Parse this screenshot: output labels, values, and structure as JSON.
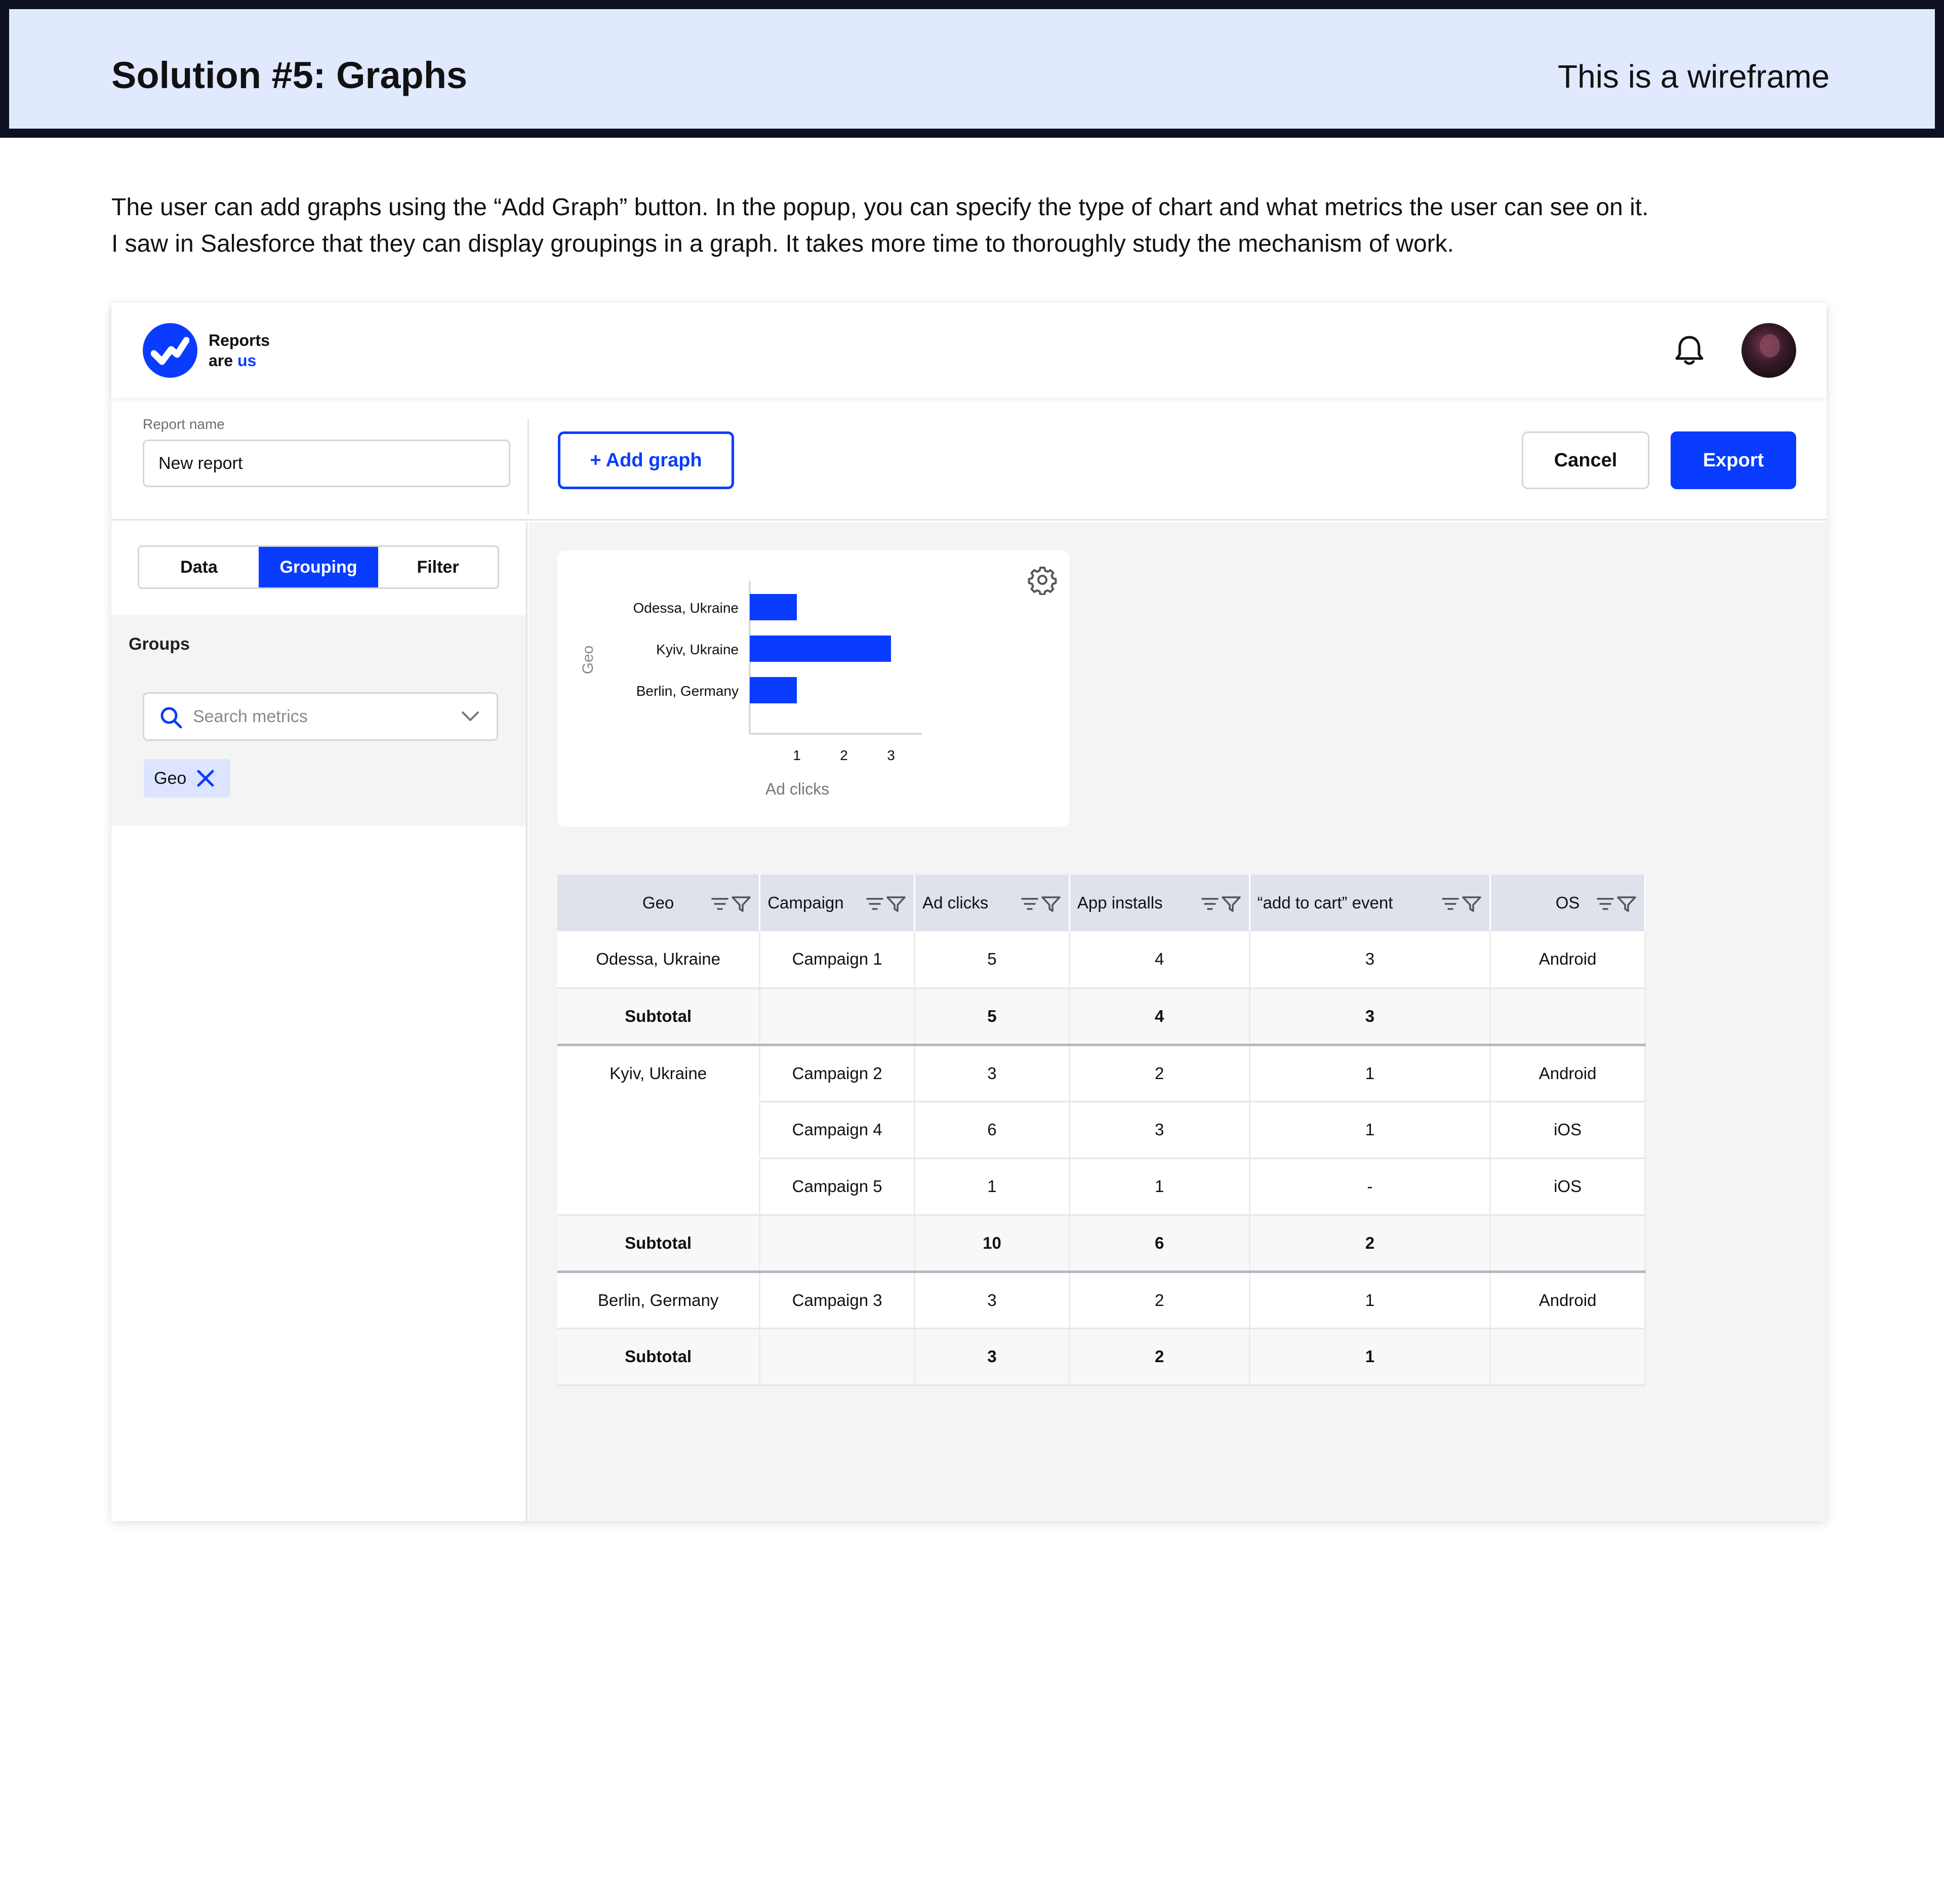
{
  "banner": {
    "title": "Solution #5: Graphs",
    "note": "This is a wireframe"
  },
  "description": {
    "line1": "The user can add graphs using the “Add Graph” button. In the popup, you can specify the type of chart and what metrics the user can see on it.",
    "line2": "I saw in Salesforce that they can display groupings in a graph. It takes more time to thoroughly study the mechanism of work."
  },
  "app": {
    "logo_line1": "Reports",
    "logo_line2_a": "are ",
    "logo_line2_b": "us",
    "icons": {
      "notification": "bell-icon",
      "user": "avatar"
    },
    "report_name_label": "Report name",
    "report_name_value": "New report",
    "add_graph_label": "+ Add graph",
    "cancel_label": "Cancel",
    "export_label": "Export",
    "tabs": [
      {
        "label": "Data",
        "active": false
      },
      {
        "label": "Grouping",
        "active": true
      },
      {
        "label": "Filter",
        "active": false
      }
    ],
    "groups_title": "Groups",
    "search_placeholder": "Search metrics",
    "chip_label": "Geo",
    "accent_color": "#0a3cff"
  },
  "chart_data": {
    "type": "bar",
    "orientation": "horizontal",
    "categories": [
      "Odessa, Ukraine",
      "Kyiv, Ukraine",
      "Berlin, Germany"
    ],
    "values": [
      1,
      3,
      1
    ],
    "xlabel": "Ad clicks",
    "ylabel": "Geo",
    "xticks": [
      1,
      2,
      3
    ],
    "xlim": [
      0,
      3.6
    ],
    "grid": false,
    "color": "#0a3cff"
  },
  "table": {
    "columns": [
      "Geo",
      "Campaign",
      "Ad clicks",
      "App installs",
      "“add to cart” event",
      "OS"
    ],
    "rows": [
      {
        "cells": [
          "Odessa, Ukraine",
          "Campaign 1",
          "5",
          "4",
          "3",
          "Android"
        ],
        "kind": "data"
      },
      {
        "cells": [
          "Subtotal",
          "",
          "5",
          "4",
          "3",
          ""
        ],
        "kind": "sub"
      },
      {
        "cells": [
          "Kyiv, Ukraine",
          "Campaign 2",
          "3",
          "2",
          "1",
          "Android"
        ],
        "kind": "data"
      },
      {
        "cells": [
          "",
          "Campaign 4",
          "6",
          "3",
          "1",
          "iOS"
        ],
        "kind": "data"
      },
      {
        "cells": [
          "",
          "Campaign 5",
          "1",
          "1",
          "-",
          "iOS"
        ],
        "kind": "data"
      },
      {
        "cells": [
          "Subtotal",
          "",
          "10",
          "6",
          "2",
          ""
        ],
        "kind": "sub"
      },
      {
        "cells": [
          "Berlin, Germany",
          "Campaign 3",
          "3",
          "2",
          "1",
          "Android"
        ],
        "kind": "data"
      },
      {
        "cells": [
          "Subtotal",
          "",
          "3",
          "2",
          "1",
          ""
        ],
        "kind": "sub"
      }
    ]
  }
}
